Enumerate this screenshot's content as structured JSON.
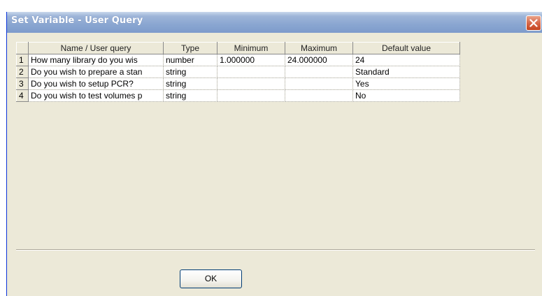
{
  "window": {
    "title": "Set Variable - User Query"
  },
  "table": {
    "headers": {
      "name": "Name / User query",
      "type": "Type",
      "minimum": "Minimum",
      "maximum": "Maximum",
      "default": "Default value"
    },
    "rows": [
      {
        "num": "1",
        "name": "How many library do you wis",
        "type": "number",
        "minimum": "1.000000",
        "maximum": "24.000000",
        "default": "24"
      },
      {
        "num": "2",
        "name": "Do you wish to prepare a stan",
        "type": "string",
        "minimum": "",
        "maximum": "",
        "default": "Standard"
      },
      {
        "num": "3",
        "name": "Do you wish to setup PCR?",
        "type": "string",
        "minimum": "",
        "maximum": "",
        "default": "Yes"
      },
      {
        "num": "4",
        "name": "Do you wish to test volumes p",
        "type": "string",
        "minimum": "",
        "maximum": "",
        "default": "No"
      }
    ]
  },
  "buttons": {
    "ok_label": "OK"
  },
  "colors": {
    "titlebar": "#8aa6d1",
    "close_button": "#d8684a",
    "dialog_background": "#ece9d8"
  },
  "icons": {
    "close": "close-icon"
  }
}
